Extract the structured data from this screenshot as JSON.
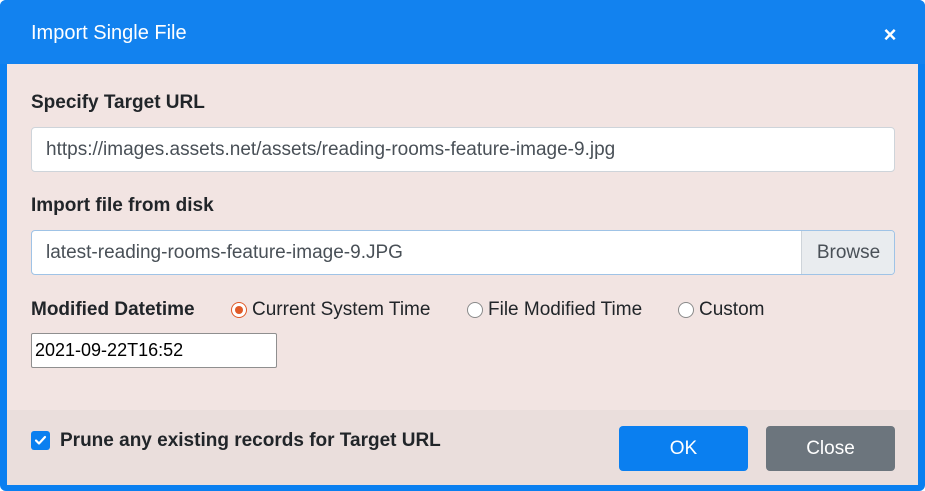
{
  "dialog": {
    "title": "Import Single File",
    "close_icon": "close-icon"
  },
  "target_url": {
    "label": "Specify Target URL",
    "value": "https://images.assets.net/assets/reading-rooms-feature-image-9.jpg"
  },
  "import_file": {
    "label": "Import file from disk",
    "file_name": "latest-reading-rooms-feature-image-9.JPG",
    "browse_label": "Browse"
  },
  "modified_datetime": {
    "label": "Modified Datetime",
    "options": [
      {
        "label": "Current System Time",
        "checked": true
      },
      {
        "label": "File Modified Time",
        "checked": false
      },
      {
        "label": "Custom",
        "checked": false
      }
    ],
    "value": "2021-09-22T16:52"
  },
  "footer": {
    "prune_label": "Prune any existing records for Target URL",
    "prune_checked": true,
    "ok_label": "OK",
    "close_label": "Close"
  },
  "colors": {
    "primary": "#0a7ff0",
    "radio_accent": "#e05a28",
    "secondary": "#6c757d",
    "body_bg": "#f2e4e2"
  }
}
